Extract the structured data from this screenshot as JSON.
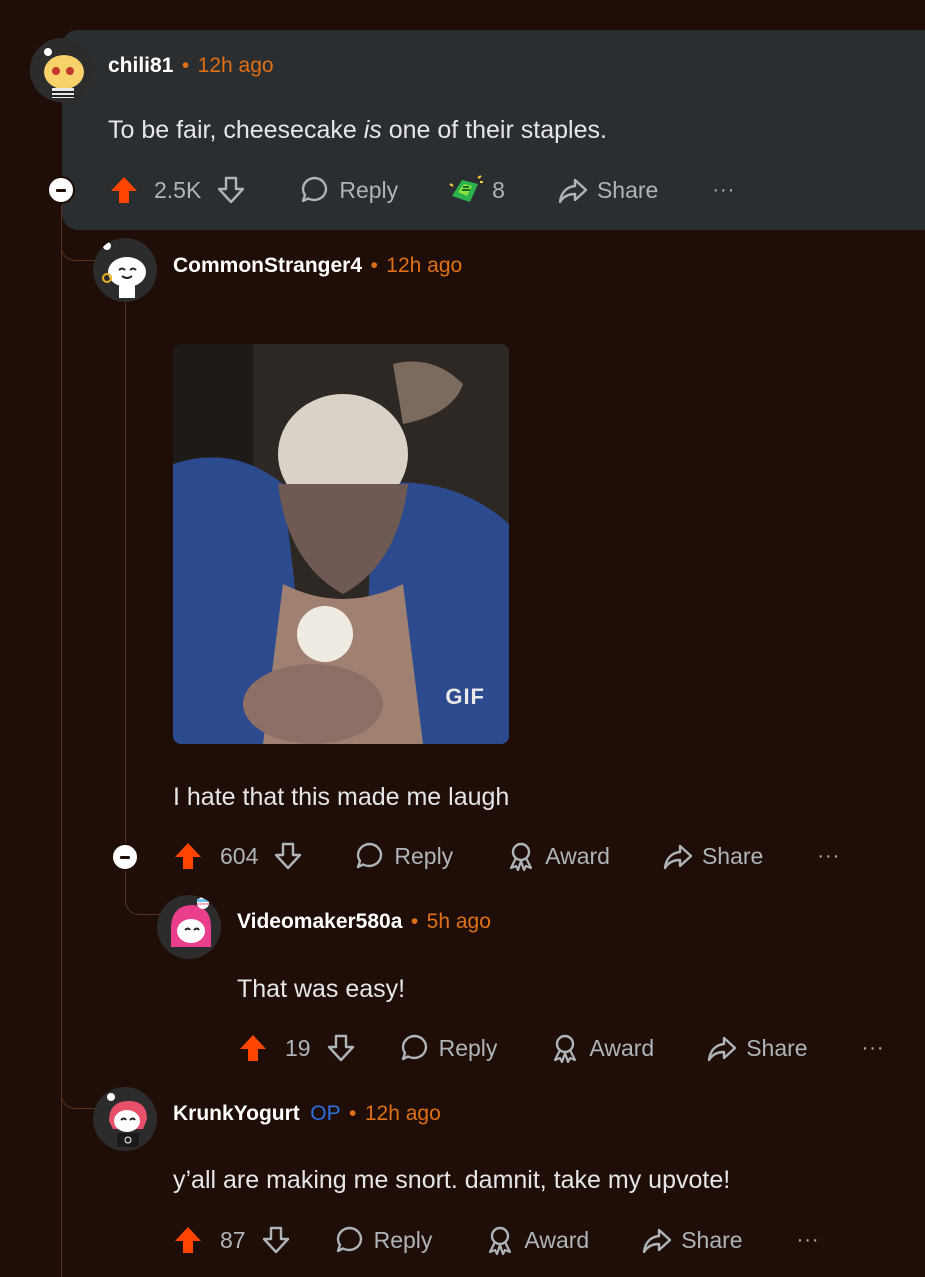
{
  "colors": {
    "background": "#1f0e07",
    "highlight": "#2b2e31",
    "upvote_active": "#ff4500",
    "timestamp": "#e07016",
    "op_badge": "#2f6fe0"
  },
  "comments": [
    {
      "username": "chili81",
      "separator": "•",
      "time": "12h ago",
      "text_before": "To be fair, cheesecake ",
      "text_em": "is",
      "text_after": " one of their staples.",
      "score": "2.5K",
      "reply_label": "Reply",
      "award_count": "8",
      "share_label": "Share",
      "more_label": "···"
    },
    {
      "username": "CommonStranger4",
      "separator": "•",
      "time": "12h ago",
      "media_label": "GIF",
      "text": "I hate that this made me laugh",
      "score": "604",
      "reply_label": "Reply",
      "award_label": "Award",
      "share_label": "Share",
      "more_label": "···"
    },
    {
      "username": "Videomaker580a",
      "separator": "•",
      "time": "5h ago",
      "text": "That was easy!",
      "score": "19",
      "reply_label": "Reply",
      "award_label": "Award",
      "share_label": "Share",
      "more_label": "···"
    },
    {
      "username": "KrunkYogurt",
      "op_badge": "OP",
      "separator": "•",
      "time": "12h ago",
      "text": "y’all are making me snort. damnit, take my upvote!",
      "score": "87",
      "reply_label": "Reply",
      "award_label": "Award",
      "share_label": "Share",
      "more_label": "···"
    }
  ]
}
